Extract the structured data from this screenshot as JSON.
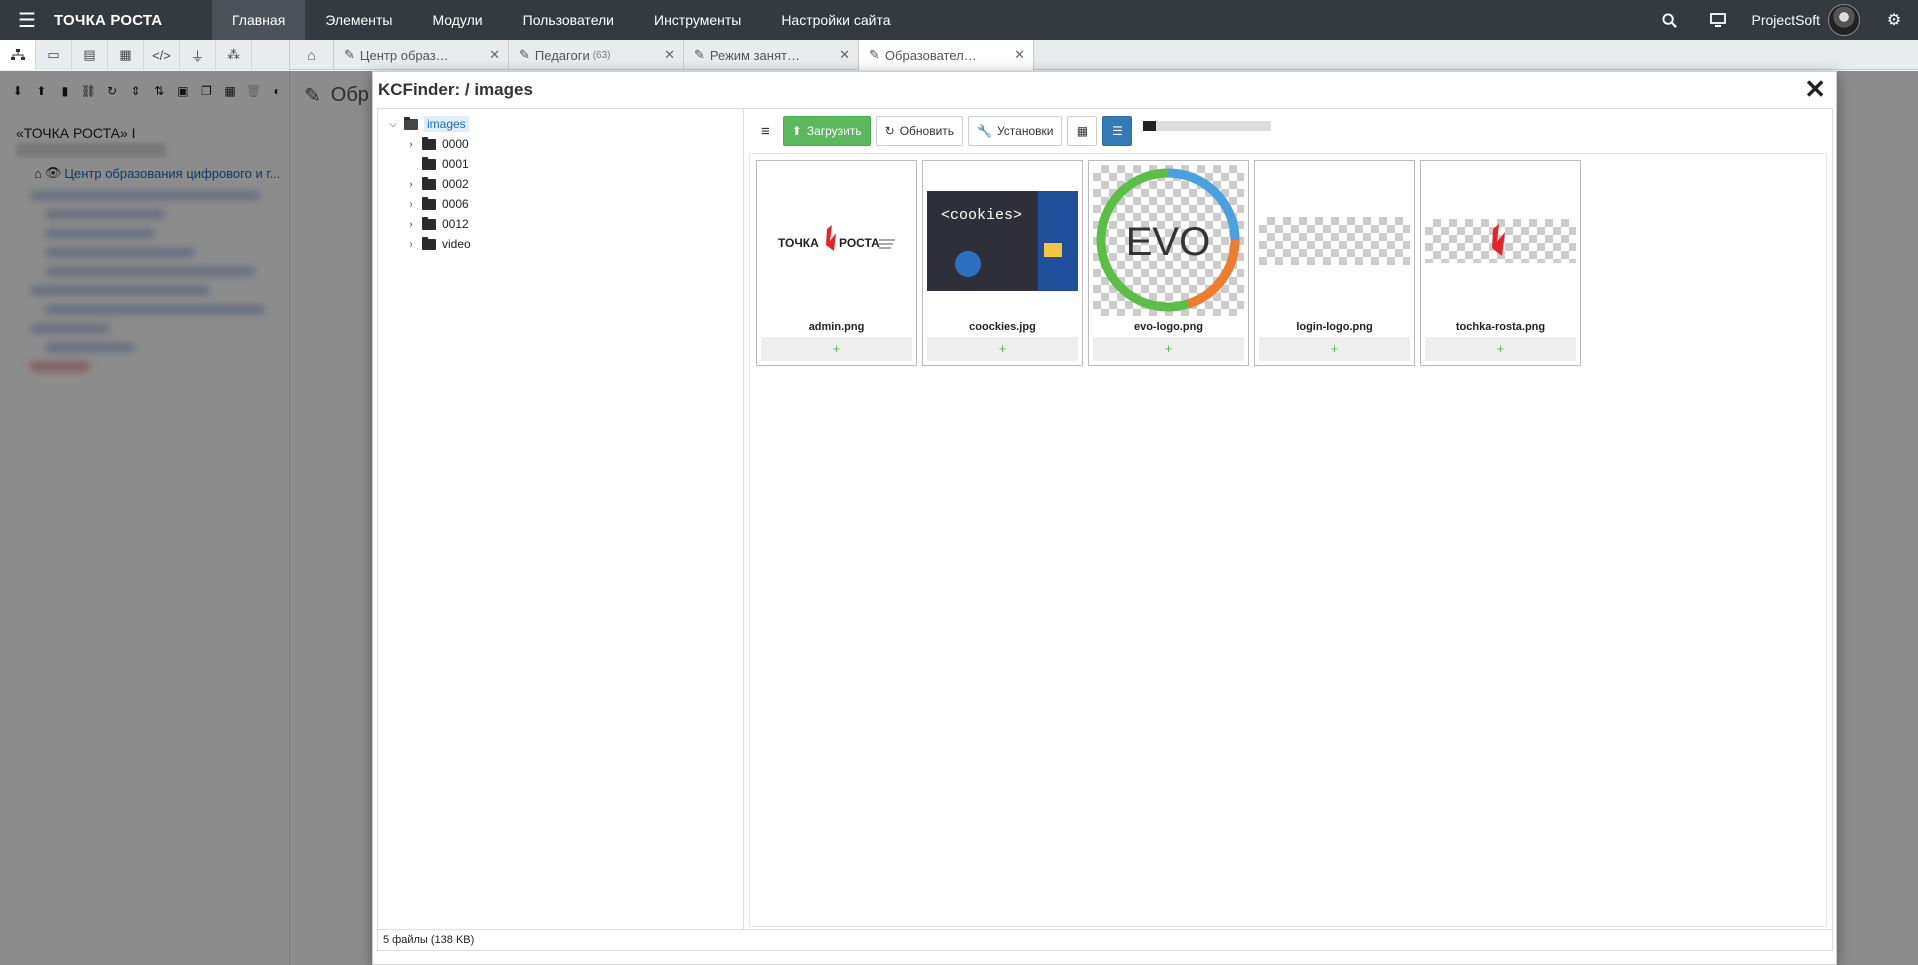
{
  "topbar": {
    "brand": "ТОЧКА РОСТА",
    "nav": [
      "Главная",
      "Элементы",
      "Модули",
      "Пользователи",
      "Инструменты",
      "Настройки сайта"
    ],
    "user": "ProjectSoft"
  },
  "tabs": [
    {
      "label": "Центр образ…"
    },
    {
      "label": "Педагоги",
      "count": "(63)"
    },
    {
      "label": "Режим занят…"
    },
    {
      "label": "Образовател…"
    }
  ],
  "sidebar": {
    "site_title": "«ТОЧКА РОСТА» I",
    "root_item": "Центр образования цифрового и г..."
  },
  "editor": {
    "title": "Обр"
  },
  "modal": {
    "title": "KCFinder: / images",
    "tree": {
      "root": "images",
      "folders": [
        "0000",
        "0001",
        "0002",
        "0006",
        "0012",
        "video"
      ],
      "expandable": [
        true,
        false,
        true,
        true,
        true,
        true
      ]
    },
    "toolbar": {
      "upload": "Загрузить",
      "refresh": "Обновить",
      "settings": "Установки"
    },
    "progress": 0.1,
    "files": [
      {
        "name": "admin.png",
        "add": "+"
      },
      {
        "name": "coockies.jpg",
        "add": "+",
        "thumb_text": "<cookies>"
      },
      {
        "name": "evo-logo.png",
        "add": "+",
        "thumb_text": "EVO"
      },
      {
        "name": "login-logo.png",
        "add": "+"
      },
      {
        "name": "tochka-rosta.png",
        "add": "+"
      }
    ],
    "status": "5 файлы (138 KB)"
  },
  "colors": {
    "topbar": "#343a40",
    "upload": "#5cb85c",
    "active_view": "#337ab7",
    "brand_red": "#e52328",
    "link": "#1a6ec4"
  }
}
